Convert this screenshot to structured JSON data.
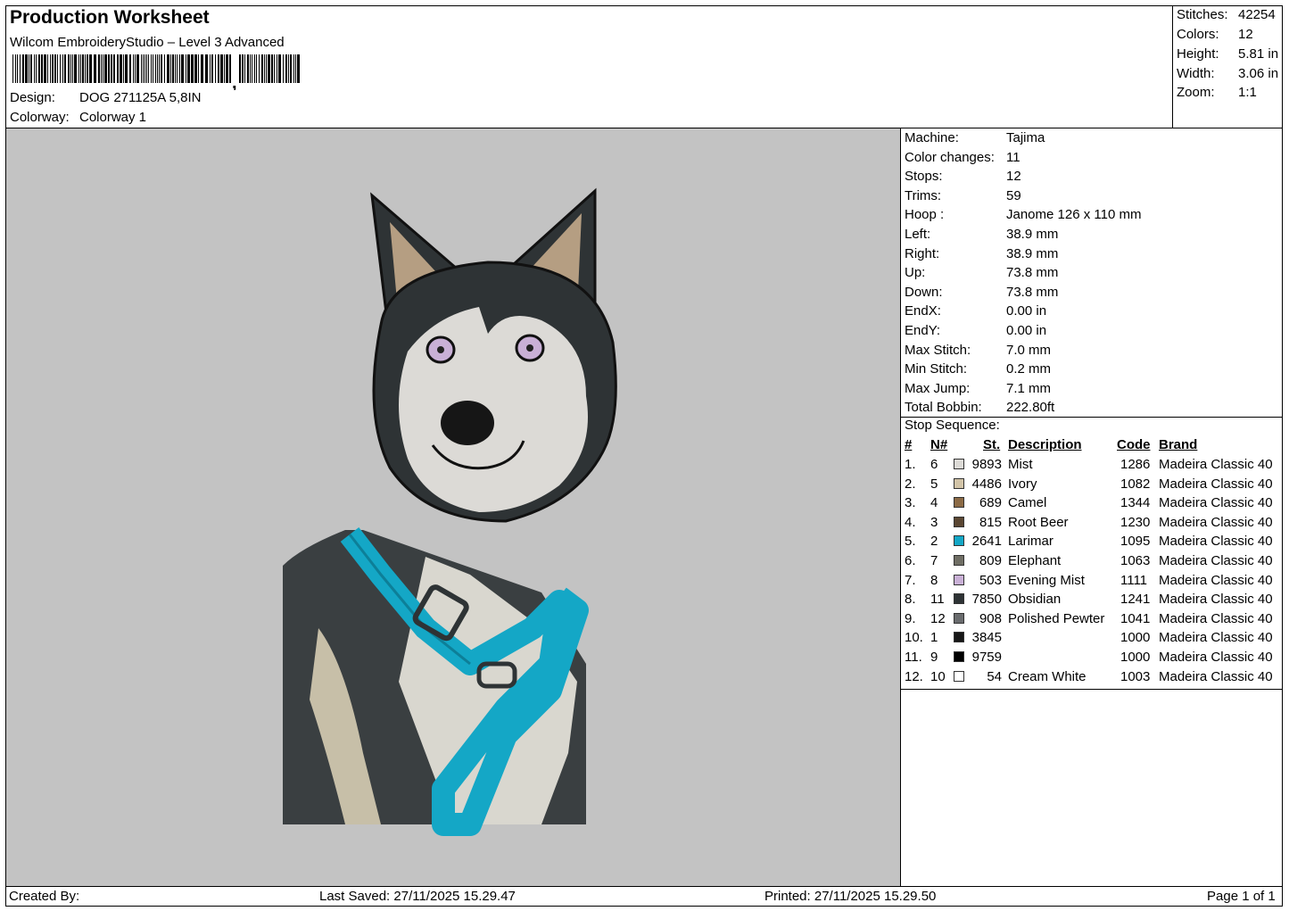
{
  "header": {
    "title": "Production Worksheet",
    "subtitle": "Wilcom EmbroideryStudio – Level 3 Advanced",
    "design_label": "Design:",
    "design_value": "DOG 271125A 5,8IN",
    "colorway_label": "Colorway:",
    "colorway_value": "Colorway 1"
  },
  "summary": {
    "stitches_label": "Stitches:",
    "stitches": "42254",
    "colors_label": "Colors:",
    "colors": "12",
    "height_label": "Height:",
    "height": "5.81 in",
    "width_label": "Width:",
    "width": "3.06 in",
    "zoom_label": "Zoom:",
    "zoom": "1:1"
  },
  "info": [
    {
      "k": "Machine:",
      "v": "Tajima"
    },
    {
      "k": "Color changes:",
      "v": "11"
    },
    {
      "k": "Stops:",
      "v": "12"
    },
    {
      "k": "Trims:",
      "v": "59"
    },
    {
      "k": "Hoop :",
      "v": "Janome 126 x 110 mm"
    },
    {
      "k": "Left:",
      "v": "38.9 mm"
    },
    {
      "k": "Right:",
      "v": "38.9 mm"
    },
    {
      "k": "Up:",
      "v": "73.8 mm"
    },
    {
      "k": "Down:",
      "v": "73.8 mm"
    },
    {
      "k": "EndX:",
      "v": "0.00 in"
    },
    {
      "k": "EndY:",
      "v": "0.00 in"
    },
    {
      "k": "Max Stitch:",
      "v": "7.0 mm"
    },
    {
      "k": "Min Stitch:",
      "v": "0.2 mm"
    },
    {
      "k": "Max Jump:",
      "v": "7.1 mm"
    },
    {
      "k": "Total Bobbin:",
      "v": "222.80ft"
    }
  ],
  "sequence": {
    "title": "Stop Sequence:",
    "headers": {
      "idx": "#",
      "n": "N#",
      "st": "St.",
      "desc": "Description",
      "code": "Code",
      "brand": "Brand"
    },
    "rows": [
      {
        "idx": "1.",
        "n": "6",
        "st": "9893",
        "desc": "Mist",
        "code": "1286",
        "brand": "Madeira Classic 40",
        "color": "#dcdad6"
      },
      {
        "idx": "2.",
        "n": "5",
        "st": "4486",
        "desc": "Ivory",
        "code": "1082",
        "brand": "Madeira Classic 40",
        "color": "#d2c4a8"
      },
      {
        "idx": "3.",
        "n": "4",
        "st": "689",
        "desc": "Camel",
        "code": "1344",
        "brand": "Madeira Classic 40",
        "color": "#8b6a45"
      },
      {
        "idx": "4.",
        "n": "3",
        "st": "815",
        "desc": "Root Beer",
        "code": "1230",
        "brand": "Madeira Classic 40",
        "color": "#5a4632"
      },
      {
        "idx": "5.",
        "n": "2",
        "st": "2641",
        "desc": "Larimar",
        "code": "1095",
        "brand": "Madeira Classic 40",
        "color": "#14a7c6"
      },
      {
        "idx": "6.",
        "n": "7",
        "st": "809",
        "desc": "Elephant",
        "code": "1063",
        "brand": "Madeira Classic 40",
        "color": "#6f6e64"
      },
      {
        "idx": "7.",
        "n": "8",
        "st": "503",
        "desc": "Evening Mist",
        "code": "1111",
        "brand": "Madeira Classic 40",
        "color": "#c9b0d6"
      },
      {
        "idx": "8.",
        "n": "11",
        "st": "7850",
        "desc": "Obsidian",
        "code": "1241",
        "brand": "Madeira Classic 40",
        "color": "#2e3335"
      },
      {
        "idx": "9.",
        "n": "12",
        "st": "908",
        "desc": "Polished Pewter",
        "code": "1041",
        "brand": "Madeira Classic 40",
        "color": "#6a6c6e"
      },
      {
        "idx": "10.",
        "n": "1",
        "st": "3845",
        "desc": "",
        "code": "1000",
        "brand": "Madeira Classic 40",
        "color": "#161616"
      },
      {
        "idx": "11.",
        "n": "9",
        "st": "9759",
        "desc": "",
        "code": "1000",
        "brand": "Madeira Classic 40",
        "color": "#000000"
      },
      {
        "idx": "12.",
        "n": "10",
        "st": "54",
        "desc": "Cream White",
        "code": "1003",
        "brand": "Madeira Classic 40",
        "color": "#ffffff"
      }
    ]
  },
  "footer": {
    "created_by": "Created By:",
    "last_saved": "Last Saved: 27/11/2025 15.29.47",
    "printed": "Printed: 27/11/2025 15.29.50",
    "page": "Page 1 of 1"
  },
  "colors": {
    "preview_bg": "#c3c3c3",
    "larimar": "#14a7c6"
  }
}
